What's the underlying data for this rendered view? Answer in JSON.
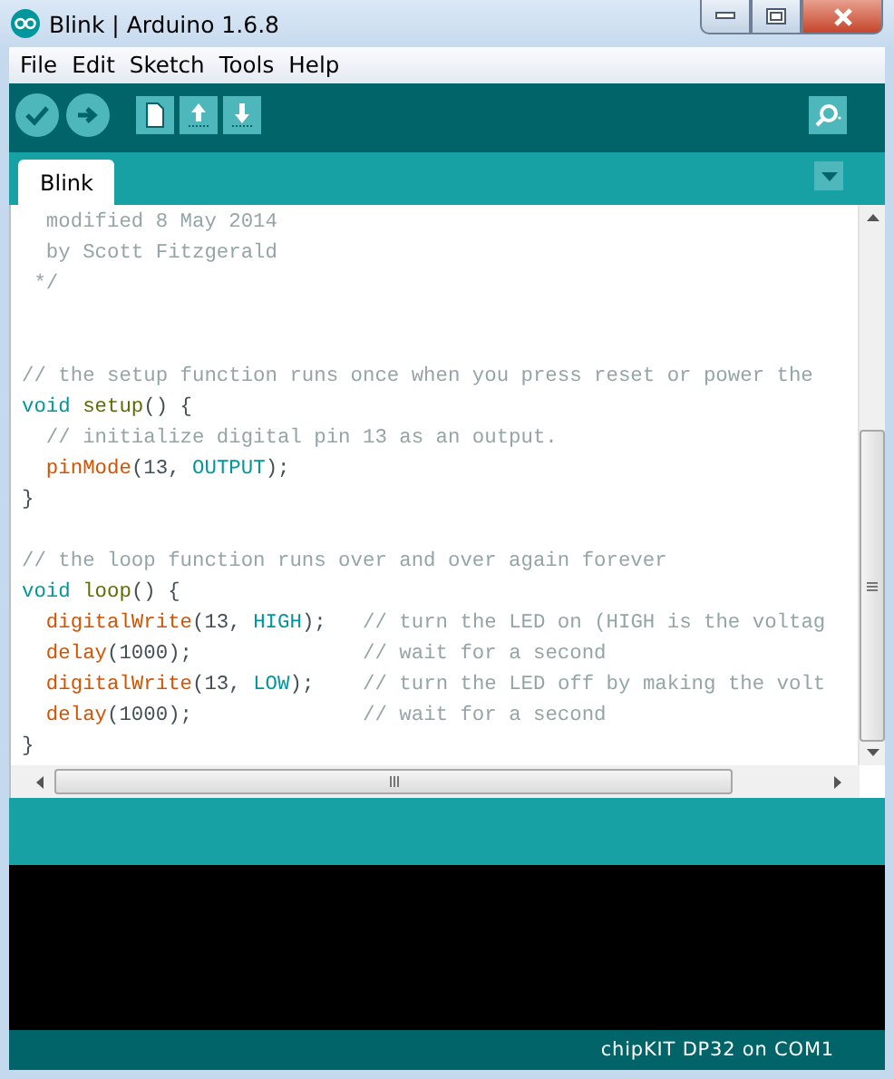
{
  "window": {
    "title": "Blink | Arduino 1.6.8"
  },
  "menu": [
    "File",
    "Edit",
    "Sketch",
    "Tools",
    "Help"
  ],
  "tabs": [
    {
      "label": "Blink",
      "selected": true
    }
  ],
  "editor": {
    "lines": [
      {
        "kind": "code",
        "segments": [
          {
            "kind": "comment",
            "text": "  modified 8 May 2014"
          }
        ]
      },
      {
        "kind": "code",
        "segments": [
          {
            "kind": "comment",
            "text": "  by Scott Fitzgerald"
          }
        ]
      },
      {
        "kind": "code",
        "segments": [
          {
            "kind": "comment",
            "text": " */"
          }
        ]
      },
      {
        "kind": "blank"
      },
      {
        "kind": "blank"
      },
      {
        "kind": "code",
        "segments": [
          {
            "kind": "comment",
            "text": "// the setup function runs once when you press reset or power the"
          }
        ]
      },
      {
        "kind": "code",
        "segments": [
          {
            "kind": "keyword",
            "text": "void "
          },
          {
            "kind": "function",
            "text": "setup"
          },
          {
            "kind": "plain",
            "text": "() {"
          }
        ]
      },
      {
        "kind": "code",
        "segments": [
          {
            "kind": "comment",
            "text": "  // initialize digital pin 13 as an output."
          }
        ]
      },
      {
        "kind": "code",
        "segments": [
          {
            "kind": "builtin",
            "text": "  pinMode"
          },
          {
            "kind": "plain",
            "text": "(13, "
          },
          {
            "kind": "constant",
            "text": "OUTPUT"
          },
          {
            "kind": "plain",
            "text": ");"
          }
        ]
      },
      {
        "kind": "code",
        "segments": [
          {
            "kind": "plain",
            "text": "}"
          }
        ]
      },
      {
        "kind": "blank"
      },
      {
        "kind": "code",
        "segments": [
          {
            "kind": "comment",
            "text": "// the loop function runs over and over again forever"
          }
        ]
      },
      {
        "kind": "code",
        "segments": [
          {
            "kind": "keyword",
            "text": "void "
          },
          {
            "kind": "function",
            "text": "loop"
          },
          {
            "kind": "plain",
            "text": "() {"
          }
        ]
      },
      {
        "kind": "code",
        "segments": [
          {
            "kind": "builtin",
            "text": "  digitalWrite"
          },
          {
            "kind": "plain",
            "text": "(13, "
          },
          {
            "kind": "constant",
            "text": "HIGH"
          },
          {
            "kind": "plain",
            "text": ");   "
          },
          {
            "kind": "comment",
            "text": "// turn the LED on (HIGH is the voltag"
          }
        ]
      },
      {
        "kind": "code",
        "segments": [
          {
            "kind": "builtin",
            "text": "  delay"
          },
          {
            "kind": "plain",
            "text": "(1000);              "
          },
          {
            "kind": "comment",
            "text": "// wait for a second"
          }
        ]
      },
      {
        "kind": "code",
        "segments": [
          {
            "kind": "builtin",
            "text": "  digitalWrite"
          },
          {
            "kind": "plain",
            "text": "(13, "
          },
          {
            "kind": "constant",
            "text": "LOW"
          },
          {
            "kind": "plain",
            "text": ");    "
          },
          {
            "kind": "comment",
            "text": "// turn the LED off by making the volt"
          }
        ]
      },
      {
        "kind": "code",
        "segments": [
          {
            "kind": "builtin",
            "text": "  delay"
          },
          {
            "kind": "plain",
            "text": "(1000);              "
          },
          {
            "kind": "comment",
            "text": "// wait for a second"
          }
        ]
      },
      {
        "kind": "code",
        "segments": [
          {
            "kind": "plain",
            "text": "}"
          }
        ]
      }
    ]
  },
  "status_bar": {
    "board": "chipKIT DP32 on COM1"
  }
}
